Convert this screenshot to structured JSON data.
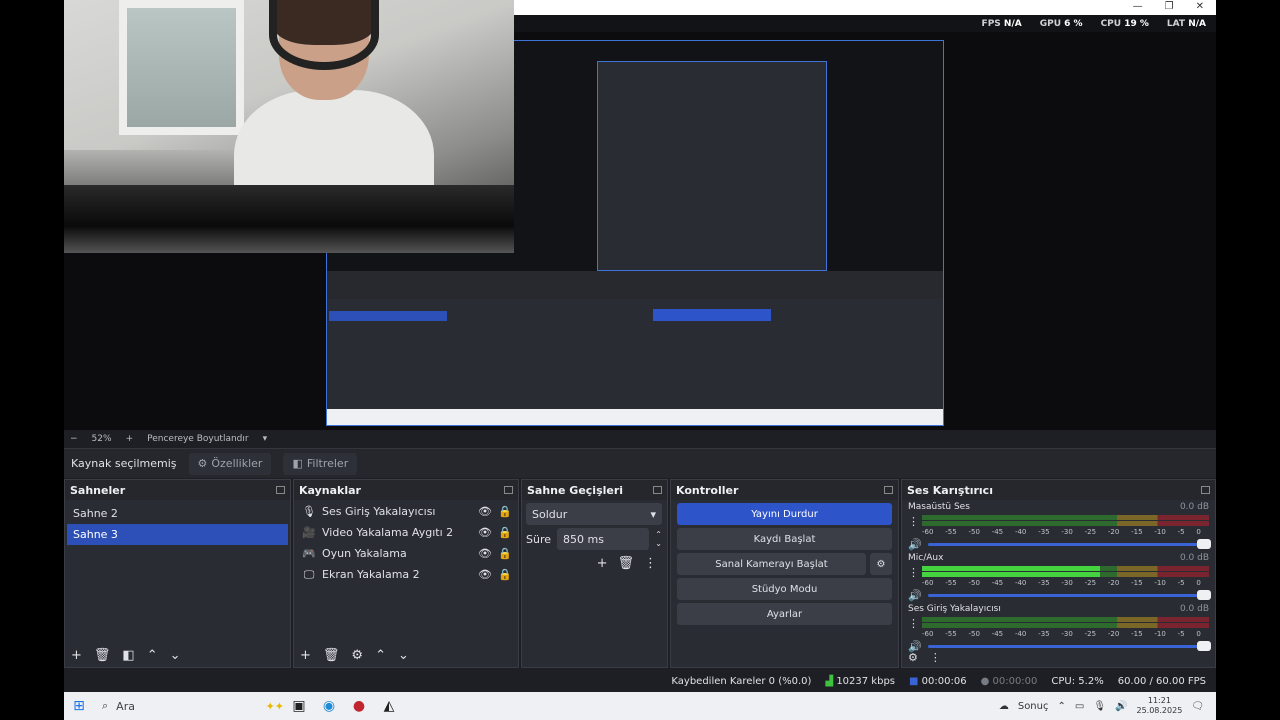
{
  "stats": {
    "fps": "FPS",
    "fps_val": "N/A",
    "gpu": "GPU",
    "gpu_val": "6 %",
    "cpu": "CPU",
    "cpu_val": "19 %",
    "lat": "LAT",
    "lat_val": "N/A"
  },
  "preview_bar": {
    "zoom": "52%",
    "mode": "Pencereye Boyutlandır"
  },
  "source_bar": {
    "label": "Kaynak seçilmemiş",
    "properties": "Özellikler",
    "filters": "Filtreler"
  },
  "scenes": {
    "title": "Sahneler",
    "items": [
      {
        "label": "Sahne 2"
      },
      {
        "label": "Sahne 3"
      }
    ]
  },
  "sources": {
    "title": "Kaynaklar",
    "items": [
      {
        "label": "Ses Giriş Yakalayıcısı",
        "icon": "microphone-icon"
      },
      {
        "label": "Video Yakalama Aygıtı 2",
        "icon": "camera-icon"
      },
      {
        "label": "Oyun Yakalama",
        "icon": "gamepad-icon"
      },
      {
        "label": "Ekran Yakalama 2",
        "icon": "monitor-icon"
      }
    ]
  },
  "transitions": {
    "title": "Sahne Geçişleri",
    "type": "Soldur",
    "duration_label": "Süre",
    "duration": "850 ms"
  },
  "controls": {
    "title": "Kontroller",
    "stop_stream": "Yayını Durdur",
    "start_record": "Kaydı Başlat",
    "virtual_cam": "Sanal Kamerayı Başlat",
    "studio": "Stüdyo Modu",
    "settings": "Ayarlar"
  },
  "mixer": {
    "title": "Ses Karıştırıcı",
    "channels": [
      {
        "name": "Masaüstü Ses",
        "db": "0.0 dB",
        "level": 0
      },
      {
        "name": "Mic/Aux",
        "db": "0.0 dB",
        "level": 0.62
      },
      {
        "name": "Ses Giriş Yakalayıcısı",
        "db": "0.0 dB",
        "level": 0
      }
    ],
    "ticks": [
      "-60",
      "-55",
      "-50",
      "-45",
      "-40",
      "-35",
      "-30",
      "-25",
      "-20",
      "-15",
      "-10",
      "-5",
      "0"
    ]
  },
  "status": {
    "dropped": "Kaybedilen Kareler 0 (%0.0)",
    "bitrate": "10237 kbps",
    "stream_time": "00:00:06",
    "rec_time": "00:00:00",
    "cpu": "CPU: 5.2%",
    "fps": "60.00 / 60.00 FPS"
  },
  "taskbar": {
    "search": "Ara",
    "weather": "Sonuç",
    "time": "11:21",
    "date": "25.08.2025"
  }
}
